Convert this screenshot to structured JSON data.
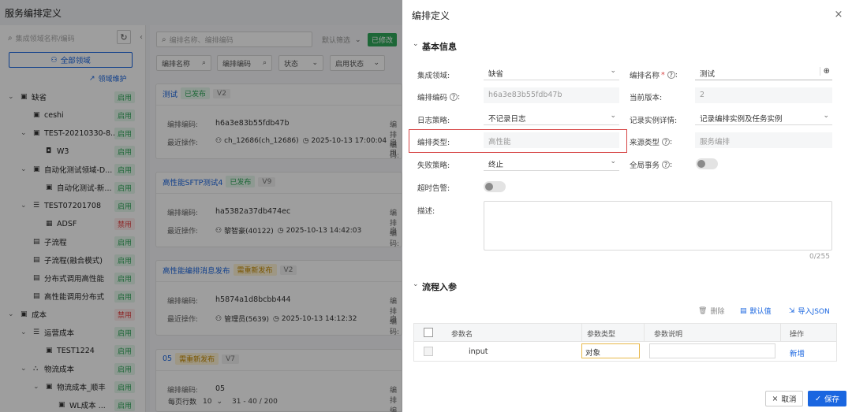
{
  "page": {
    "title": "服务编排定义"
  },
  "left": {
    "search_placeholder": "集成领域名称/编码",
    "all_domains": "全部领域",
    "maintain": "领域维护",
    "tree": [
      {
        "label": "缺省",
        "status": "启用",
        "indent": 0,
        "arrow": "⌄",
        "icon": "folder-icon"
      },
      {
        "label": "ceshi",
        "status": "启用",
        "indent": 1,
        "arrow": "",
        "icon": "folder-icon"
      },
      {
        "label": "TEST-20210330-8...",
        "status": "启用",
        "indent": 1,
        "arrow": "⌄",
        "icon": "folder-icon"
      },
      {
        "label": "W3",
        "status": "启用",
        "indent": 2,
        "arrow": "",
        "icon": "module-icon"
      },
      {
        "label": "自动化测试领域-D...",
        "status": "启用",
        "indent": 1,
        "arrow": "⌄",
        "icon": "folder-icon"
      },
      {
        "label": "自动化测试-新...",
        "status": "启用",
        "indent": 2,
        "arrow": "",
        "icon": "folder-icon"
      },
      {
        "label": "TEST07201708",
        "status": "启用",
        "indent": 1,
        "arrow": "⌄",
        "icon": "list-icon"
      },
      {
        "label": "ADSF",
        "status": "禁用",
        "indent": 2,
        "arrow": "",
        "icon": "grid-icon"
      },
      {
        "label": "子流程",
        "status": "启用",
        "indent": 1,
        "arrow": "",
        "icon": "flow-icon"
      },
      {
        "label": "子流程(融合模式)",
        "status": "启用",
        "indent": 1,
        "arrow": "",
        "icon": "flow-icon"
      },
      {
        "label": "分布式调用高性能",
        "status": "启用",
        "indent": 1,
        "arrow": "",
        "icon": "flow-icon"
      },
      {
        "label": "高性能调用分布式",
        "status": "启用",
        "indent": 1,
        "arrow": "",
        "icon": "flow-icon"
      },
      {
        "label": "成本",
        "status": "禁用",
        "indent": 0,
        "arrow": "⌄",
        "icon": "folder-icon"
      },
      {
        "label": "运营成本",
        "status": "启用",
        "indent": 1,
        "arrow": "⌄",
        "icon": "list-icon"
      },
      {
        "label": "TEST1224",
        "status": "启用",
        "indent": 2,
        "arrow": "",
        "icon": "folder-icon"
      },
      {
        "label": "物流成本",
        "status": "启用",
        "indent": 1,
        "arrow": "⌄",
        "icon": "tree-icon"
      },
      {
        "label": "物流成本_顺丰",
        "status": "启用",
        "indent": 2,
        "arrow": "⌄",
        "icon": "folder-icon"
      },
      {
        "label": "WL成本 ...",
        "status": "启用",
        "indent": 3,
        "arrow": "",
        "icon": "folder-icon"
      }
    ]
  },
  "main": {
    "search_placeholder": "编排名称、编排编码",
    "filter_default": "默认筛选",
    "modified_badge": "已修改",
    "filters": [
      "编排名称",
      "编排编码",
      "状态",
      "启用状态"
    ],
    "code_label": "编排编码:",
    "last_op_label": "最近操作:",
    "enable_trunc": "启用",
    "enable_trunc2": "启",
    "cards": [
      {
        "name": "测试",
        "status": "已发布",
        "version": "V2",
        "code": "h6a3e83b55fdb47b",
        "user": "ch_12686(ch_12686)",
        "time": "2025-10-13 17:00:04"
      },
      {
        "name": "高性能SFTP测试4",
        "status": "已发布",
        "version": "V9",
        "code": "ha5382a37db474ec",
        "user": "黎智豪(40122)",
        "time": "2025-10-13 14:42:03"
      },
      {
        "name": "高性能编排消息发布",
        "status": "需重新发布",
        "version": "V2",
        "code": "h5874a1d8bcbb444",
        "user": "管理员(5639)",
        "time": "2025-10-13 14:12:32"
      },
      {
        "name": "05",
        "status": "需重新发布",
        "version": "V7",
        "code": "05",
        "user": "",
        "time": ""
      }
    ],
    "pager": {
      "per_page_label": "每页行数",
      "per_page": "10",
      "range": "31 - 40 / 200"
    }
  },
  "drawer": {
    "title": "编排定义",
    "basic_section": "基本信息",
    "fields": {
      "domain": {
        "label": "集成领域:",
        "value": "缺省"
      },
      "name": {
        "label": "编排名称",
        "required": "*",
        "value": "测试"
      },
      "code": {
        "label": "编排编码",
        "value": "h6a3e83b55fdb47b"
      },
      "version": {
        "label": "当前版本:",
        "value": "2"
      },
      "log": {
        "label": "日志策略:",
        "value": "不记录日志"
      },
      "record": {
        "label": "记录实例详情:",
        "value": "记录编排实例及任务实例"
      },
      "type": {
        "label": "编排类型:",
        "value": "高性能"
      },
      "source": {
        "label": "来源类型",
        "value": "服务编排"
      },
      "fail": {
        "label": "失败策略:",
        "value": "终止"
      },
      "global_tx": {
        "label": "全局事务"
      },
      "timeout": {
        "label": "超时告警:"
      },
      "desc": {
        "label": "描述:",
        "counter": "0/255"
      }
    },
    "params_section": "流程入参",
    "params_actions": {
      "delete": "删除",
      "default": "默认值",
      "import": "导入JSON"
    },
    "table": {
      "headers": [
        "参数名",
        "参数类型",
        "参数说明",
        "操作"
      ],
      "rows": [
        {
          "name": "input",
          "type": "对象",
          "desc": "",
          "op": "新增"
        }
      ]
    },
    "footer": {
      "cancel": "取消",
      "save": "保存"
    }
  },
  "colors": {
    "primary": "#1a66e0",
    "enabled_bg": "#e6f7ec",
    "enabled_text": "#2fa65a",
    "disabled_text": "#e54545",
    "highlight_border": "#d64545"
  }
}
